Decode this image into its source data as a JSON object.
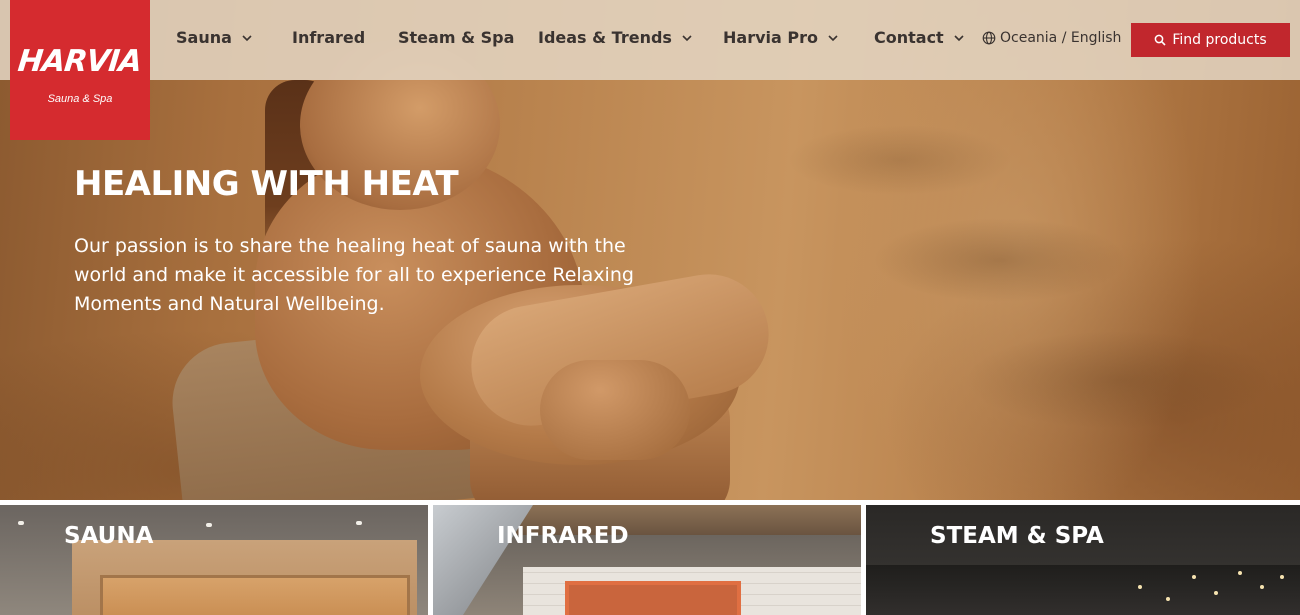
{
  "brand": {
    "name": "HARVIA",
    "tagline": "Sauna & Spa",
    "accent_color": "#d52b2f"
  },
  "nav": {
    "items": [
      {
        "label": "Sauna",
        "has_dropdown": true
      },
      {
        "label": "Infrared",
        "has_dropdown": false
      },
      {
        "label": "Steam & Spa",
        "has_dropdown": false
      },
      {
        "label": "Ideas & Trends",
        "has_dropdown": true
      },
      {
        "label": "Harvia Pro",
        "has_dropdown": true
      },
      {
        "label": "Contact",
        "has_dropdown": true
      }
    ],
    "language": "Oceania / English",
    "language_icon": "globe-icon",
    "cta_label": "Find products",
    "cta_icon": "search-icon",
    "cta_color": "#c1272d"
  },
  "hero": {
    "title": "HEALING WITH HEAT",
    "text": "Our passion is to share the healing heat of sauna with the world and make it accessible for all to experience Relaxing Moments and Natural Wellbeing."
  },
  "categories": [
    {
      "title": "SAUNA"
    },
    {
      "title": "INFRARED"
    },
    {
      "title": "STEAM & SPA"
    }
  ]
}
